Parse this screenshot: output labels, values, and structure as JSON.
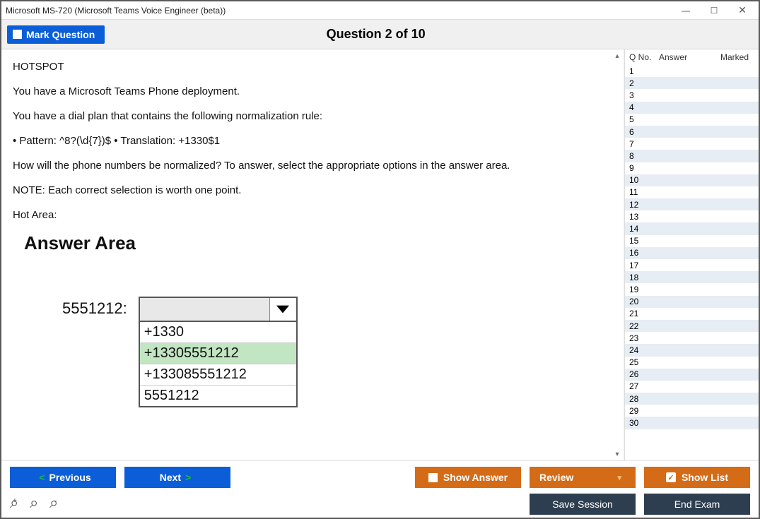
{
  "window": {
    "title": "Microsoft MS-720 (Microsoft Teams Voice Engineer (beta))"
  },
  "topbar": {
    "mark_label": "Mark Question",
    "question_title": "Question 2 of 10"
  },
  "question": {
    "heading": "HOTSPOT",
    "p1": "You have a Microsoft Teams Phone deployment.",
    "p2": "You have a dial plan that contains the following normalization rule:",
    "p3": "• Pattern: ^8?(\\d{7})$ • Translation: +1330$1",
    "p4": "How will the phone numbers be normalized? To answer, select the appropriate options in the answer area.",
    "p5": "NOTE: Each correct selection is worth one point.",
    "p6": "Hot Area:",
    "answer_heading": "Answer Area",
    "hotspot_label": "5551212:",
    "options": [
      "+1330",
      "+13305551212",
      "+133085551212",
      "5551212"
    ],
    "selected_index": 1
  },
  "sidebar": {
    "col_qno": "Q No.",
    "col_answer": "Answer",
    "col_marked": "Marked",
    "rows": [
      1,
      2,
      3,
      4,
      5,
      6,
      7,
      8,
      9,
      10,
      11,
      12,
      13,
      14,
      15,
      16,
      17,
      18,
      19,
      20,
      21,
      22,
      23,
      24,
      25,
      26,
      27,
      28,
      29,
      30
    ]
  },
  "buttons": {
    "previous": "Previous",
    "next": "Next",
    "show_answer": "Show Answer",
    "review": "Review",
    "show_list": "Show List",
    "save_session": "Save Session",
    "end_exam": "End Exam"
  }
}
